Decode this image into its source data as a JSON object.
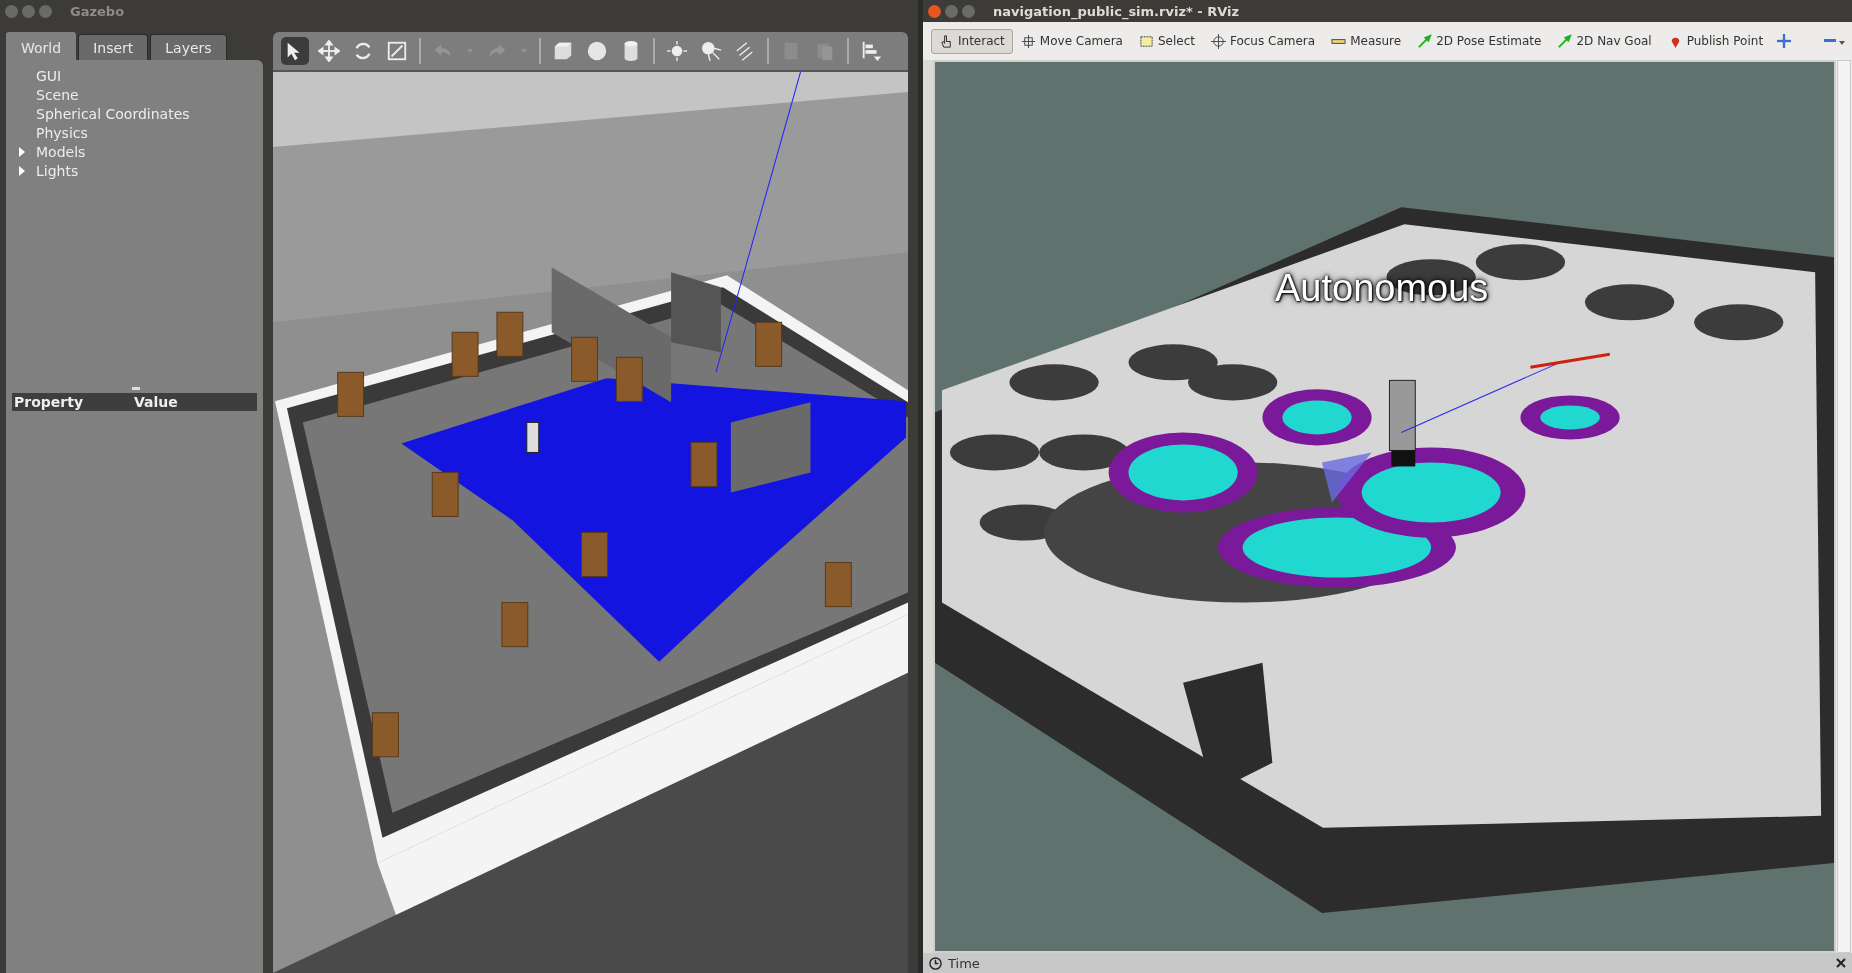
{
  "gazebo": {
    "window": {
      "title": "Gazebo",
      "active": false
    },
    "tabs": [
      {
        "label": "World",
        "selected": true
      },
      {
        "label": "Insert",
        "selected": false
      },
      {
        "label": "Layers",
        "selected": false
      }
    ],
    "tree": [
      {
        "label": "GUI"
      },
      {
        "label": "Scene"
      },
      {
        "label": "Spherical Coordinates"
      },
      {
        "label": "Physics"
      },
      {
        "label": "Models",
        "expanded": false
      },
      {
        "label": "Lights",
        "expanded": false
      }
    ],
    "property_columns": [
      "Property",
      "Value"
    ],
    "toolbar": [
      {
        "kind": "select",
        "selected": true
      },
      {
        "kind": "move",
        "selected": false
      },
      {
        "kind": "rotate",
        "selected": false
      },
      {
        "kind": "scale",
        "selected": false
      },
      {
        "kind": "sep"
      },
      {
        "kind": "undo",
        "disabled": true
      },
      {
        "kind": "drop",
        "disabled": true
      },
      {
        "kind": "redo",
        "disabled": true
      },
      {
        "kind": "drop",
        "disabled": true
      },
      {
        "kind": "sep"
      },
      {
        "kind": "box"
      },
      {
        "kind": "sphere"
      },
      {
        "kind": "cylinder"
      },
      {
        "kind": "sep"
      },
      {
        "kind": "pointlight"
      },
      {
        "kind": "spotlight"
      },
      {
        "kind": "dirlight"
      },
      {
        "kind": "sep"
      },
      {
        "kind": "copy",
        "disabled": true
      },
      {
        "kind": "paste",
        "disabled": true
      },
      {
        "kind": "sep"
      },
      {
        "kind": "align"
      }
    ]
  },
  "rviz": {
    "window": {
      "title": "navigation_public_sim.rviz* - RViz",
      "active": true
    },
    "tools": [
      {
        "label": "Interact",
        "kind": "hand",
        "selected": true
      },
      {
        "label": "Move Camera",
        "kind": "move",
        "selected": false
      },
      {
        "label": "Select",
        "kind": "select",
        "selected": false
      },
      {
        "label": "Focus Camera",
        "kind": "focus",
        "selected": false
      },
      {
        "label": "Measure",
        "kind": "ruler",
        "selected": false
      },
      {
        "label": "2D Pose Estimate",
        "kind": "arrow",
        "selected": false
      },
      {
        "label": "2D Nav Goal",
        "kind": "arrow",
        "selected": false
      },
      {
        "label": "Publish Point",
        "kind": "pin",
        "selected": false
      }
    ],
    "overlay_text": "Autonomous",
    "bottom_panel": {
      "title": "Time"
    }
  }
}
